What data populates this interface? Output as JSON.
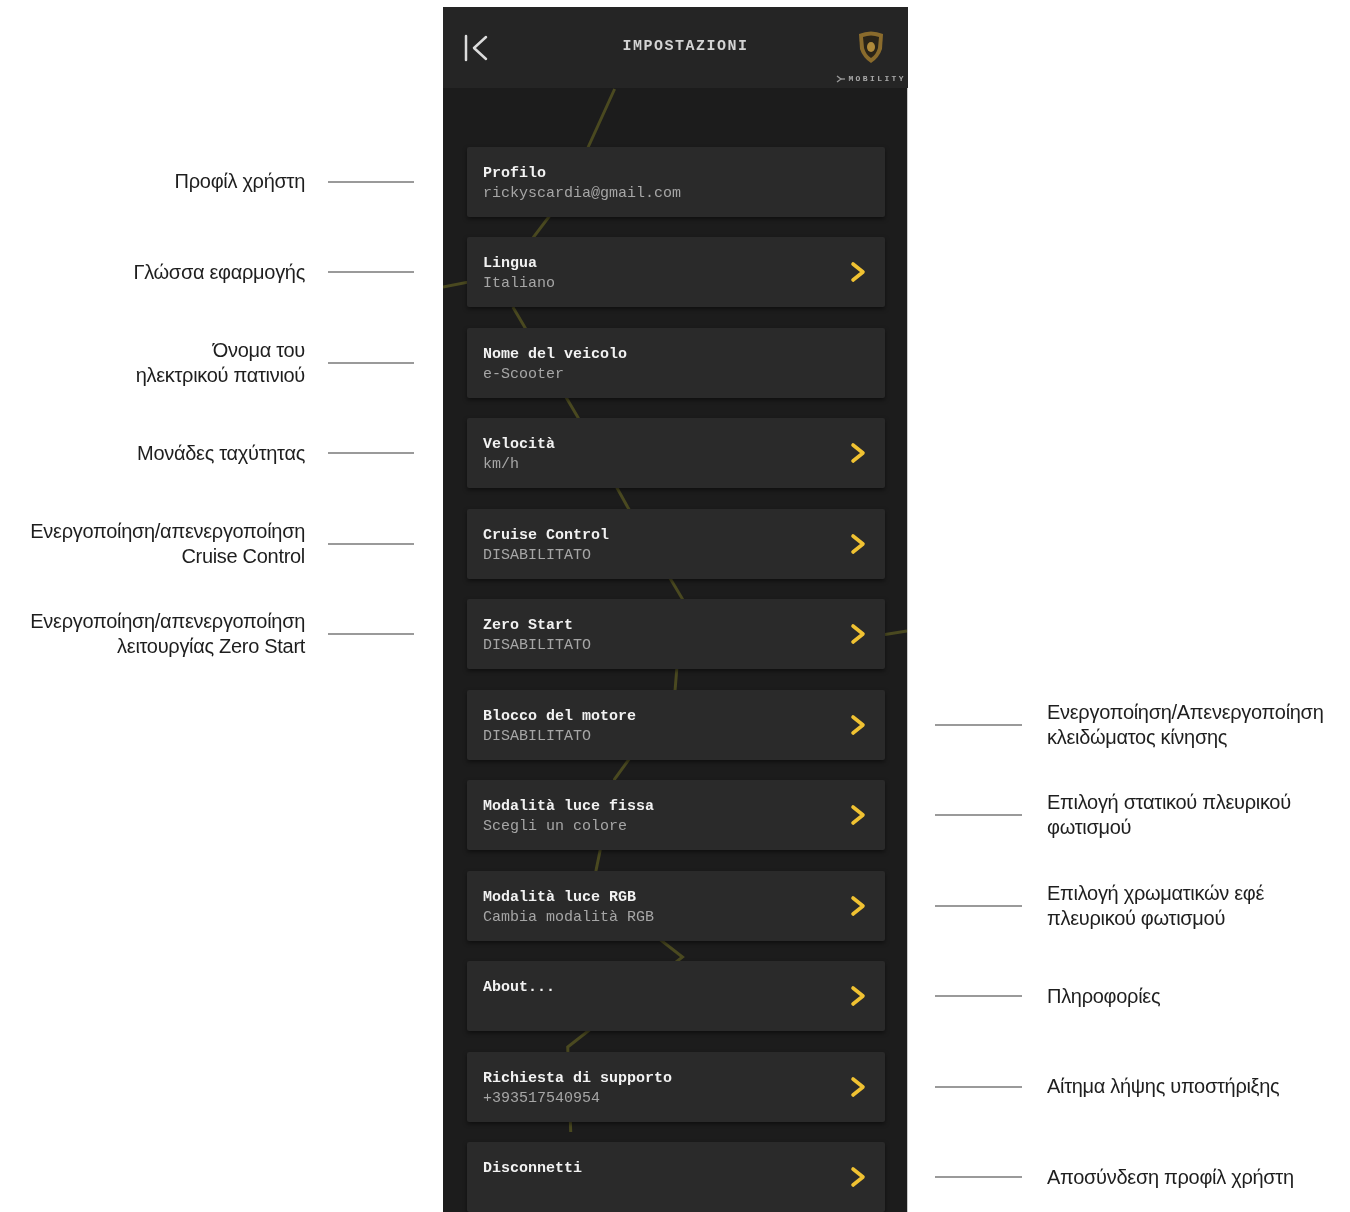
{
  "header": {
    "title": "IMPOSTAZIONI",
    "brand": "MOBILITY"
  },
  "settings": [
    {
      "title": "Profilo",
      "value": "rickyscardia@gmail.com",
      "arrow": false,
      "callout": {
        "kind": "left",
        "text": "Προφίλ χρήστη"
      }
    },
    {
      "title": "Lingua",
      "value": "Italiano",
      "arrow": true,
      "callout": {
        "kind": "left",
        "text": "Γλώσσα εφαρμογής"
      }
    },
    {
      "title": "Nome del veicolo",
      "value": "e-Scooter",
      "arrow": false,
      "callout": {
        "kind": "left",
        "text": "Όνομα του\nηλεκτρικού πατινιού"
      }
    },
    {
      "title": "Velocità",
      "value": "km/h",
      "arrow": true,
      "callout": {
        "kind": "left",
        "text": "Μονάδες ταχύτητας"
      }
    },
    {
      "title": "Cruise Control",
      "value": "DISABILITATO",
      "arrow": true,
      "callout": {
        "kind": "left",
        "text": "Ενεργοποίηση/απενεργοποίηση\nCruise Control"
      }
    },
    {
      "title": "Zero Start",
      "value": "DISABILITATO",
      "arrow": true,
      "callout": {
        "kind": "left",
        "text": "Ενεργοποίηση/απενεργοποίηση\nλειτουργίας Zero Start"
      }
    },
    {
      "title": "Blocco del motore",
      "value": "DISABILITATO",
      "arrow": true,
      "callout": {
        "kind": "right",
        "text": "Ενεργοποίηση/Απενεργοποίηση\nκλειδώματος κίνησης"
      }
    },
    {
      "title": "Modalità luce fissa",
      "value": "Scegli un colore",
      "arrow": true,
      "callout": {
        "kind": "right",
        "text": "Επιλογή στατικού πλευρικού\nφωτισμού"
      }
    },
    {
      "title": "Modalità luce RGB",
      "value": "Cambia modalità RGB",
      "arrow": true,
      "callout": {
        "kind": "right",
        "text": "Επιλογή χρωματικών εφέ\nπλευρικού φωτισμού"
      }
    },
    {
      "title": "About...",
      "arrow": true,
      "callout": {
        "kind": "right",
        "text": "Πληροφορίες"
      }
    },
    {
      "title": "Richiesta di supporto",
      "value": "+393517540954",
      "arrow": true,
      "callout": {
        "kind": "right",
        "text": "Αίτημα λήψης υποστήριξης"
      }
    },
    {
      "title": "Disconnetti",
      "arrow": true,
      "callout": {
        "kind": "right",
        "text": "Αποσύνδεση προφίλ χρήστη"
      }
    }
  ]
}
